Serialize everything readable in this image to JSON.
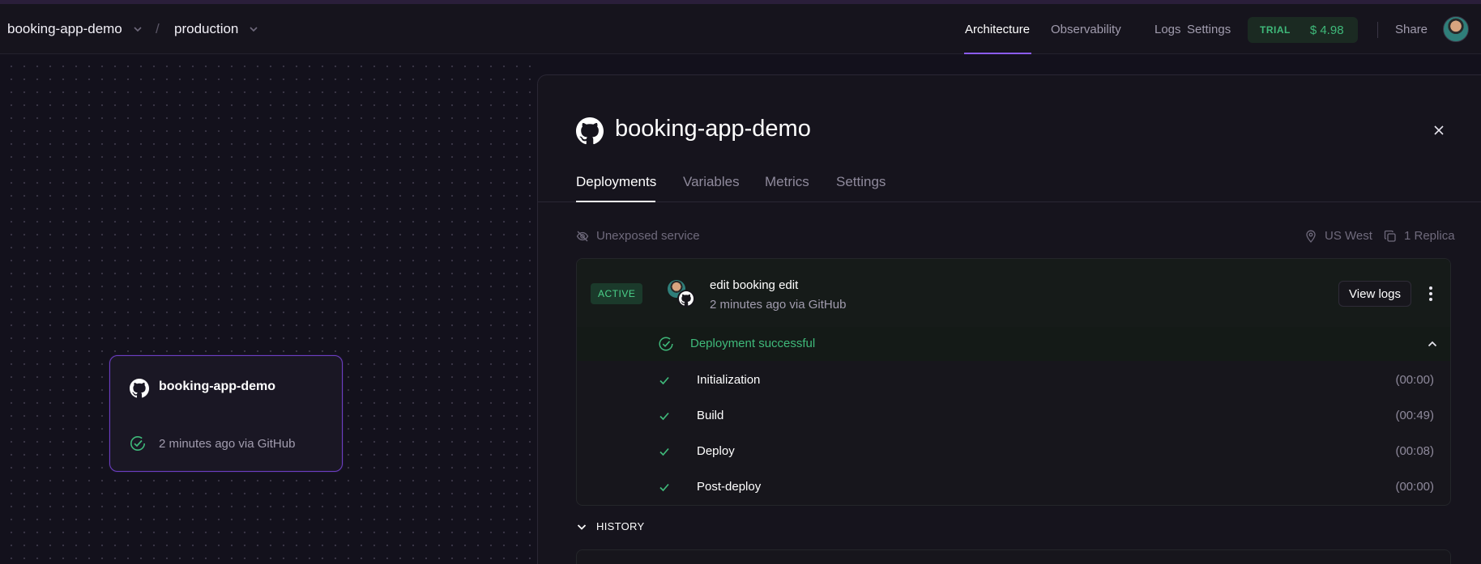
{
  "topbar": {
    "project": "booking-app-demo",
    "separator": "/",
    "environment": "production",
    "nav": [
      "Architecture",
      "Observability",
      "Logs",
      "Settings"
    ],
    "active_nav": "Architecture",
    "trial_label": "TRIAL",
    "trial_amount": "$ 4.98",
    "share_label": "Share"
  },
  "canvas": {
    "service_card": {
      "title": "booking-app-demo",
      "meta": "2 minutes ago via GitHub"
    }
  },
  "panel": {
    "title": "booking-app-demo",
    "tabs": [
      "Deployments",
      "Variables",
      "Metrics",
      "Settings"
    ],
    "active_tab": "Deployments",
    "unexposed": "Unexposed service",
    "region": "US West",
    "replicas": "1 Replica",
    "deployment": {
      "badge": "ACTIVE",
      "commit_title": "edit booking edit",
      "commit_meta": "2 minutes ago via GitHub",
      "view_logs": "View logs",
      "status": "Deployment successful",
      "steps": [
        {
          "label": "Initialization",
          "duration": "(00:00)"
        },
        {
          "label": "Build",
          "duration": "(00:49)"
        },
        {
          "label": "Deploy",
          "duration": "(00:08)"
        },
        {
          "label": "Post-deploy",
          "duration": "(00:00)"
        }
      ]
    },
    "history_label": "HISTORY"
  },
  "colors": {
    "accent_purple": "#8b5cf6",
    "success_green": "#3fb97a",
    "background": "#13111c"
  }
}
